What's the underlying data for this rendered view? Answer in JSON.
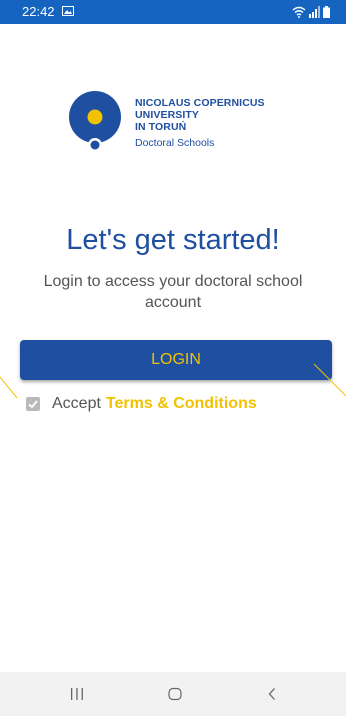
{
  "status_bar": {
    "time": "22:42",
    "icons": [
      "gallery-icon",
      "wifi-icon",
      "signal-icon",
      "battery-icon"
    ]
  },
  "logo": {
    "lines": [
      "NICOLAUS COPERNICUS",
      "UNIVERSITY",
      "IN TORUŃ"
    ],
    "subtitle": "Doctoral Schools"
  },
  "headline": "Let's get started!",
  "subtext": "Login to access your doctoral school account",
  "login_button": {
    "label": "LOGIN"
  },
  "accept": {
    "checked": true,
    "label": "Accept",
    "link": "Terms & Conditions"
  },
  "nav_bar": {
    "icons": [
      "recent-apps-icon",
      "home-icon",
      "back-icon"
    ]
  },
  "colors": {
    "status_bar": "#1565c0",
    "brand_blue": "#1f4fa0",
    "accent_yellow": "#f2c200",
    "text_gray": "#555555",
    "nav_bar": "#f2f2f2"
  }
}
